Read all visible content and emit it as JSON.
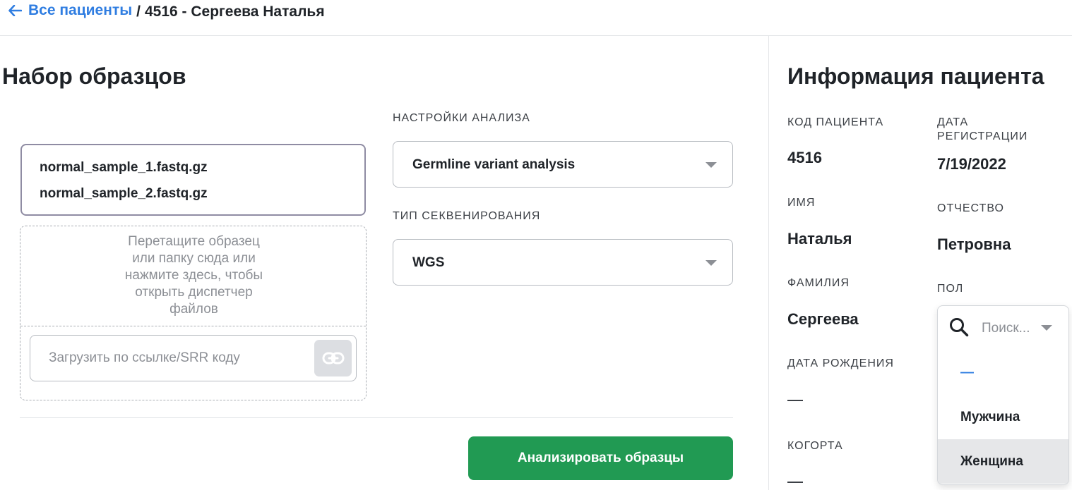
{
  "breadcrumb": {
    "back_label": "Все пациенты",
    "separator": "/",
    "current": "4516 - Сергеева Наталья"
  },
  "samples": {
    "title": "Набор образцов",
    "files": [
      "normal_sample_1.fastq.gz",
      "normal_sample_2.fastq.gz"
    ],
    "dropzone_lines": [
      "Перетащите образец",
      "или папку сюда или",
      "нажмите здесь, чтобы",
      "открыть диспетчер",
      "файлов"
    ],
    "link_placeholder": "Загрузить по ссылке/SRR коду",
    "link_value": ""
  },
  "analysis": {
    "settings_label": "НАСТРОЙКИ АНАЛИЗА",
    "settings_value": "Germline variant analysis",
    "sequencing_label": "ТИП СЕКВЕНИРОВАНИЯ",
    "sequencing_value": "WGS",
    "submit_label": "Анализировать образцы"
  },
  "patient": {
    "title": "Информация пациента",
    "code_label": "КОД ПАЦИЕНТА",
    "code_value": "4516",
    "registration_label_line1": "ДАТА",
    "registration_label_line2": "РЕГИСТРАЦИИ",
    "registration_value": "7/19/2022",
    "first_name_label": "ИМЯ",
    "first_name_value": "Наталья",
    "patronymic_label": "ОТЧЕСТВО",
    "patronymic_value": "Петровна",
    "last_name_label": "ФАМИЛИЯ",
    "last_name_value": "Сергеева",
    "sex_label": "ПОЛ",
    "birth_date_label": "ДАТА РОЖДЕНИЯ",
    "birth_date_value": "—",
    "cohort_label": "КОГОРТА",
    "cohort_value": "—"
  },
  "sex_dropdown": {
    "search_placeholder": "Поиск...",
    "options": [
      "—",
      "Мужчина",
      "Женщина"
    ],
    "hovered_option": "Женщина"
  },
  "colors": {
    "accent_blue": "#2f7de1",
    "primary_green": "#219a53",
    "selected_file_border": "#8f8ca3"
  }
}
